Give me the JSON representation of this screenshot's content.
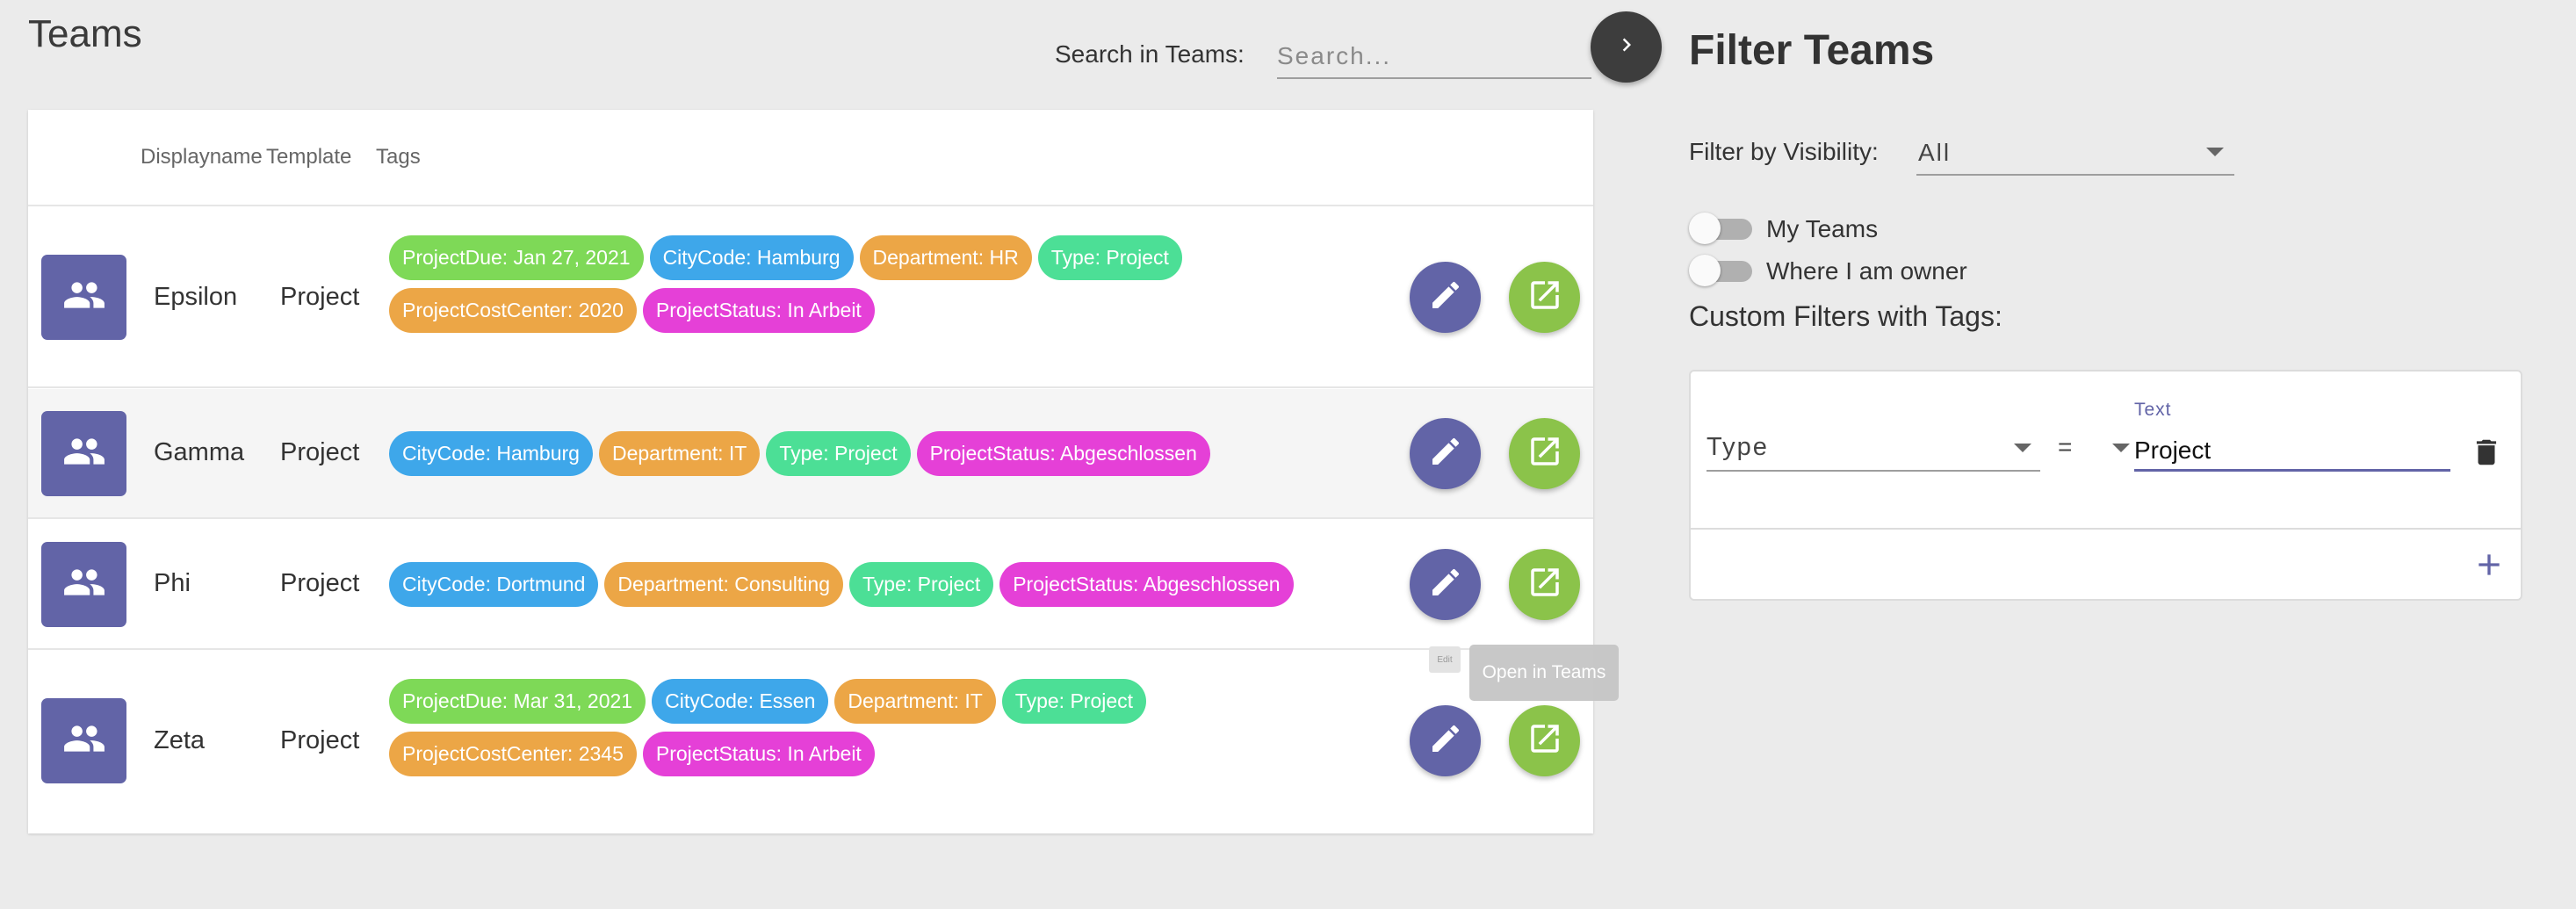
{
  "page": {
    "title": "Teams"
  },
  "search": {
    "label": "Search in Teams:",
    "placeholder": "Search..."
  },
  "table": {
    "headers": {
      "displayname": "Displayname",
      "template": "Template",
      "tags": "Tags"
    },
    "rows": [
      {
        "name": "Epsilon",
        "template": "Project",
        "tags": [
          {
            "label": "ProjectDue: Jan 27, 2021",
            "color": "#7ed957"
          },
          {
            "label": "CityCode: Hamburg",
            "color": "#3ea7ea"
          },
          {
            "label": "Department: HR",
            "color": "#eca646"
          },
          {
            "label": "Type: Project",
            "color": "#4cdf96"
          },
          {
            "label": "ProjectCostCenter: 2020",
            "color": "#eca646"
          },
          {
            "label": "ProjectStatus: In Arbeit",
            "color": "#e540d7"
          }
        ]
      },
      {
        "name": "Gamma",
        "template": "Project",
        "tags": [
          {
            "label": "CityCode: Hamburg",
            "color": "#3ea7ea"
          },
          {
            "label": "Department: IT",
            "color": "#eca646"
          },
          {
            "label": "Type: Project",
            "color": "#4cdf96"
          },
          {
            "label": "ProjectStatus: Abgeschlossen",
            "color": "#e540d7"
          }
        ]
      },
      {
        "name": "Phi",
        "template": "Project",
        "tags": [
          {
            "label": "CityCode: Dortmund",
            "color": "#3ea7ea"
          },
          {
            "label": "Department: Consulting",
            "color": "#eca646"
          },
          {
            "label": "Type: Project",
            "color": "#4cdf96"
          },
          {
            "label": "ProjectStatus: Abgeschlossen",
            "color": "#e540d7"
          }
        ]
      },
      {
        "name": "Zeta",
        "template": "Project",
        "tags": [
          {
            "label": "ProjectDue: Mar 31, 2021",
            "color": "#7ed957"
          },
          {
            "label": "CityCode: Essen",
            "color": "#3ea7ea"
          },
          {
            "label": "Department: IT",
            "color": "#eca646"
          },
          {
            "label": "Type: Project",
            "color": "#4cdf96"
          },
          {
            "label": "ProjectCostCenter: 2345",
            "color": "#eca646"
          },
          {
            "label": "ProjectStatus: In Arbeit",
            "color": "#e540d7"
          }
        ]
      }
    ]
  },
  "tooltips": {
    "edit": "Edit",
    "open": "Open in Teams"
  },
  "filter": {
    "title": "Filter Teams",
    "visibility_label": "Filter by Visibility:",
    "visibility_value": "All",
    "my_teams_label": "My Teams",
    "owner_label": "Where I am owner",
    "custom_label": "Custom Filters with Tags:",
    "rule": {
      "key": "Type",
      "operator": "=",
      "text_label": "Text",
      "text_value": "Project"
    }
  },
  "colors": {
    "accent": "#6264a7",
    "open_green": "#8bc34a",
    "dark_fab": "#3d3d3d"
  },
  "icons": {
    "collapse": "chevron-right-icon",
    "avatar": "people-icon",
    "edit": "pencil-icon",
    "open": "open-external-icon",
    "delete": "trash-icon",
    "add": "plus-icon"
  }
}
